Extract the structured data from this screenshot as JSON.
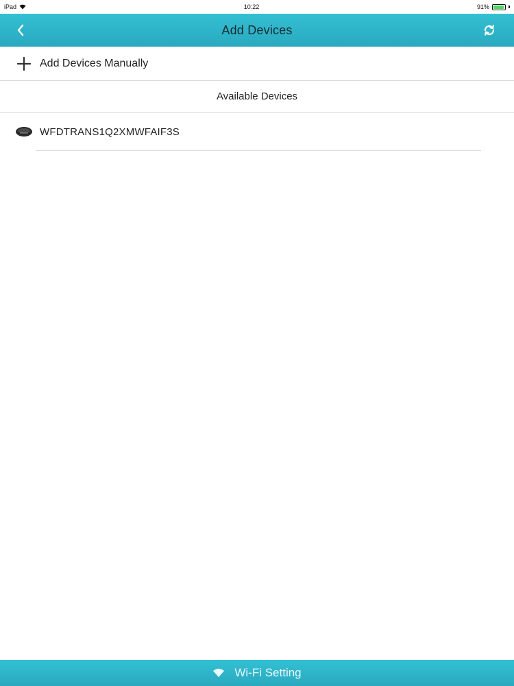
{
  "status_bar": {
    "carrier": "iPad",
    "time": "10:22",
    "battery_percent": "91%"
  },
  "nav": {
    "title": "Add Devices",
    "back_icon": "chevron-left-icon",
    "refresh_icon": "refresh-icon"
  },
  "add_manual": {
    "label": "Add Devices Manually",
    "icon": "plus-icon"
  },
  "available": {
    "header": "Available Devices",
    "devices": [
      {
        "name": "WFDTRANS1Q2XMWFAIF3S",
        "icon": "device-icon"
      }
    ]
  },
  "bottom_bar": {
    "label": "Wi-Fi Setting",
    "icon": "wifi-icon"
  },
  "colors": {
    "accent": "#2fb5ca",
    "divider": "#d9d9d9",
    "battery": "#4cd964"
  }
}
